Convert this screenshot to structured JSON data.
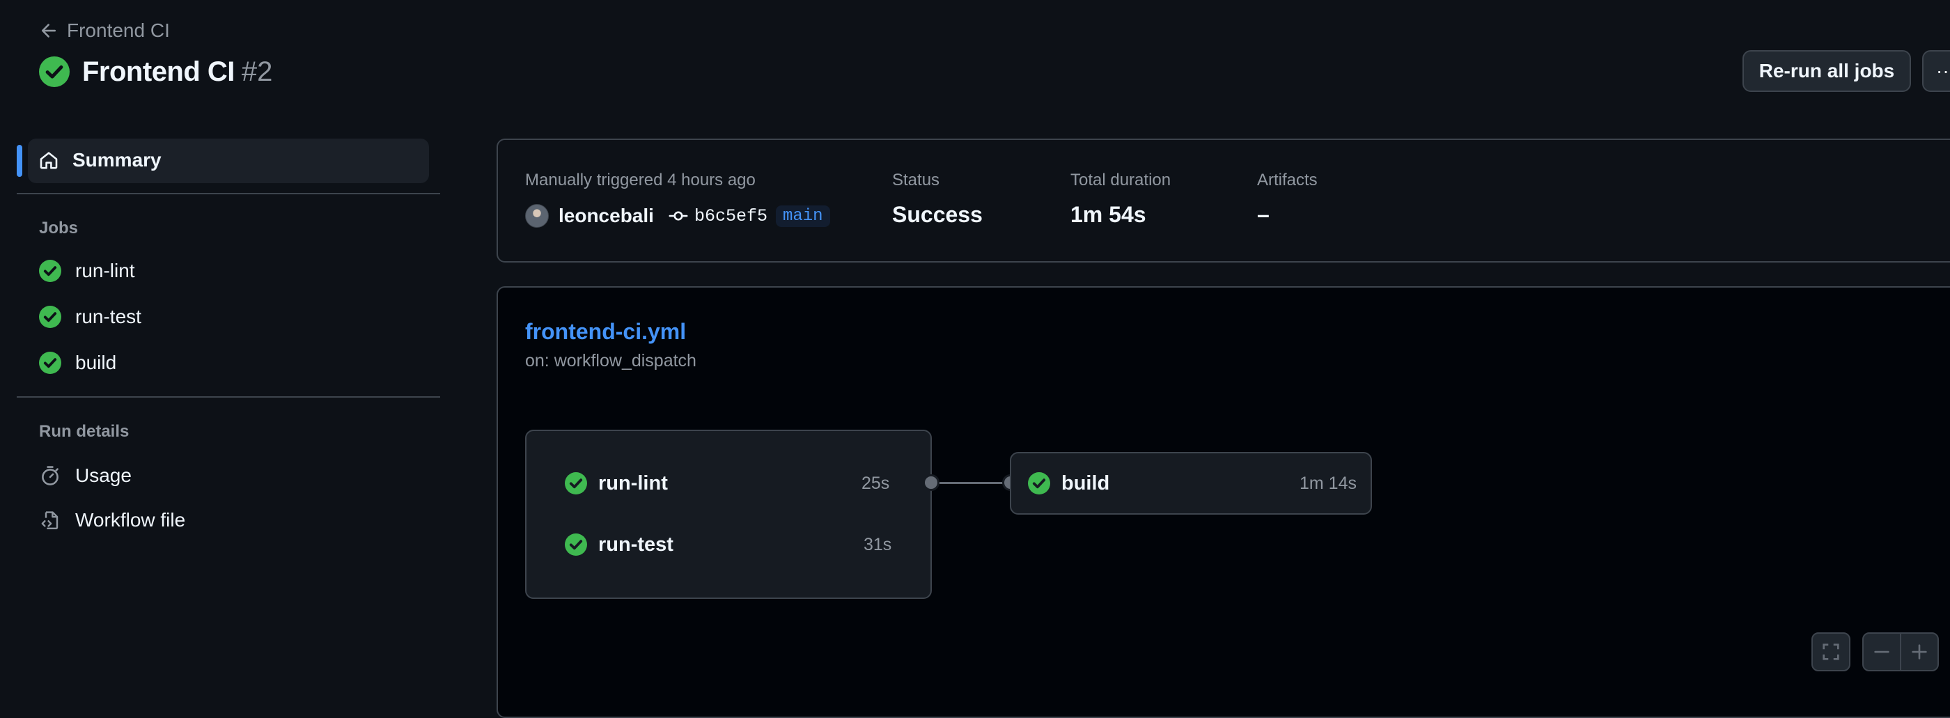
{
  "header": {
    "back_label": "Frontend CI",
    "title": "Frontend CI",
    "run_number": "#2",
    "rerun_label": "Re-run all jobs",
    "more_label": "··"
  },
  "sidebar": {
    "summary_label": "Summary",
    "jobs_heading": "Jobs",
    "jobs": [
      {
        "label": "run-lint",
        "status": "success"
      },
      {
        "label": "run-test",
        "status": "success"
      },
      {
        "label": "build",
        "status": "success"
      }
    ],
    "run_details_heading": "Run details",
    "usage_label": "Usage",
    "workflow_file_label": "Workflow file"
  },
  "summary": {
    "trigger_text": "Manually triggered 4 hours ago",
    "author": "leoncebali",
    "commit_sha": "b6c5ef5",
    "branch": "main",
    "status_label": "Status",
    "status_value": "Success",
    "duration_label": "Total duration",
    "duration_value": "1m 54s",
    "artifacts_label": "Artifacts",
    "artifacts_value": "–"
  },
  "graph": {
    "workflow_file": "frontend-ci.yml",
    "trigger": "on: workflow_dispatch",
    "jobs": [
      {
        "name": "run-lint",
        "duration": "25s"
      },
      {
        "name": "run-test",
        "duration": "31s"
      },
      {
        "name": "build",
        "duration": "1m 14s"
      }
    ]
  },
  "colors": {
    "background": "#0d1117",
    "success": "#3fb950",
    "accent": "#4493f8",
    "border": "#3d444d"
  }
}
